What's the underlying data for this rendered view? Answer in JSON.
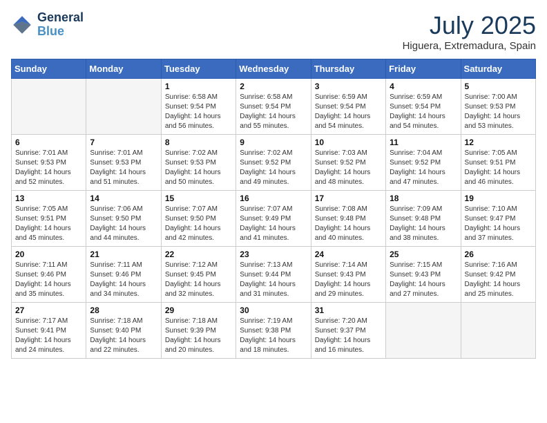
{
  "header": {
    "logo_line1": "General",
    "logo_line2": "Blue",
    "month_title": "July 2025",
    "subtitle": "Higuera, Extremadura, Spain"
  },
  "weekdays": [
    "Sunday",
    "Monday",
    "Tuesday",
    "Wednesday",
    "Thursday",
    "Friday",
    "Saturday"
  ],
  "weeks": [
    [
      {
        "day": "",
        "empty": true
      },
      {
        "day": "",
        "empty": true
      },
      {
        "day": "1",
        "sunrise": "6:58 AM",
        "sunset": "9:54 PM",
        "daylight": "14 hours and 56 minutes."
      },
      {
        "day": "2",
        "sunrise": "6:58 AM",
        "sunset": "9:54 PM",
        "daylight": "14 hours and 55 minutes."
      },
      {
        "day": "3",
        "sunrise": "6:59 AM",
        "sunset": "9:54 PM",
        "daylight": "14 hours and 54 minutes."
      },
      {
        "day": "4",
        "sunrise": "6:59 AM",
        "sunset": "9:54 PM",
        "daylight": "14 hours and 54 minutes."
      },
      {
        "day": "5",
        "sunrise": "7:00 AM",
        "sunset": "9:53 PM",
        "daylight": "14 hours and 53 minutes."
      }
    ],
    [
      {
        "day": "6",
        "sunrise": "7:01 AM",
        "sunset": "9:53 PM",
        "daylight": "14 hours and 52 minutes."
      },
      {
        "day": "7",
        "sunrise": "7:01 AM",
        "sunset": "9:53 PM",
        "daylight": "14 hours and 51 minutes."
      },
      {
        "day": "8",
        "sunrise": "7:02 AM",
        "sunset": "9:53 PM",
        "daylight": "14 hours and 50 minutes."
      },
      {
        "day": "9",
        "sunrise": "7:02 AM",
        "sunset": "9:52 PM",
        "daylight": "14 hours and 49 minutes."
      },
      {
        "day": "10",
        "sunrise": "7:03 AM",
        "sunset": "9:52 PM",
        "daylight": "14 hours and 48 minutes."
      },
      {
        "day": "11",
        "sunrise": "7:04 AM",
        "sunset": "9:52 PM",
        "daylight": "14 hours and 47 minutes."
      },
      {
        "day": "12",
        "sunrise": "7:05 AM",
        "sunset": "9:51 PM",
        "daylight": "14 hours and 46 minutes."
      }
    ],
    [
      {
        "day": "13",
        "sunrise": "7:05 AM",
        "sunset": "9:51 PM",
        "daylight": "14 hours and 45 minutes."
      },
      {
        "day": "14",
        "sunrise": "7:06 AM",
        "sunset": "9:50 PM",
        "daylight": "14 hours and 44 minutes."
      },
      {
        "day": "15",
        "sunrise": "7:07 AM",
        "sunset": "9:50 PM",
        "daylight": "14 hours and 42 minutes."
      },
      {
        "day": "16",
        "sunrise": "7:07 AM",
        "sunset": "9:49 PM",
        "daylight": "14 hours and 41 minutes."
      },
      {
        "day": "17",
        "sunrise": "7:08 AM",
        "sunset": "9:48 PM",
        "daylight": "14 hours and 40 minutes."
      },
      {
        "day": "18",
        "sunrise": "7:09 AM",
        "sunset": "9:48 PM",
        "daylight": "14 hours and 38 minutes."
      },
      {
        "day": "19",
        "sunrise": "7:10 AM",
        "sunset": "9:47 PM",
        "daylight": "14 hours and 37 minutes."
      }
    ],
    [
      {
        "day": "20",
        "sunrise": "7:11 AM",
        "sunset": "9:46 PM",
        "daylight": "14 hours and 35 minutes."
      },
      {
        "day": "21",
        "sunrise": "7:11 AM",
        "sunset": "9:46 PM",
        "daylight": "14 hours and 34 minutes."
      },
      {
        "day": "22",
        "sunrise": "7:12 AM",
        "sunset": "9:45 PM",
        "daylight": "14 hours and 32 minutes."
      },
      {
        "day": "23",
        "sunrise": "7:13 AM",
        "sunset": "9:44 PM",
        "daylight": "14 hours and 31 minutes."
      },
      {
        "day": "24",
        "sunrise": "7:14 AM",
        "sunset": "9:43 PM",
        "daylight": "14 hours and 29 minutes."
      },
      {
        "day": "25",
        "sunrise": "7:15 AM",
        "sunset": "9:43 PM",
        "daylight": "14 hours and 27 minutes."
      },
      {
        "day": "26",
        "sunrise": "7:16 AM",
        "sunset": "9:42 PM",
        "daylight": "14 hours and 25 minutes."
      }
    ],
    [
      {
        "day": "27",
        "sunrise": "7:17 AM",
        "sunset": "9:41 PM",
        "daylight": "14 hours and 24 minutes."
      },
      {
        "day": "28",
        "sunrise": "7:18 AM",
        "sunset": "9:40 PM",
        "daylight": "14 hours and 22 minutes."
      },
      {
        "day": "29",
        "sunrise": "7:18 AM",
        "sunset": "9:39 PM",
        "daylight": "14 hours and 20 minutes."
      },
      {
        "day": "30",
        "sunrise": "7:19 AM",
        "sunset": "9:38 PM",
        "daylight": "14 hours and 18 minutes."
      },
      {
        "day": "31",
        "sunrise": "7:20 AM",
        "sunset": "9:37 PM",
        "daylight": "14 hours and 16 minutes."
      },
      {
        "day": "",
        "empty": true
      },
      {
        "day": "",
        "empty": true
      }
    ]
  ]
}
